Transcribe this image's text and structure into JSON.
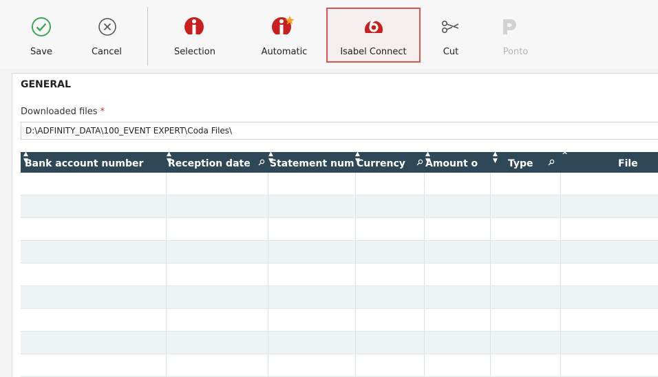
{
  "toolbar": {
    "save": "Save",
    "cancel": "Cancel",
    "selection": "Selection",
    "automatic": "Automatic",
    "isabel_connect": "Isabel Connect",
    "cut": "Cut",
    "ponto": "Ponto"
  },
  "colors": {
    "header_bg": "#2f4858",
    "save_green": "#3aa757",
    "brand_red": "#c8201e",
    "highlight_border": "#e05252"
  },
  "section": {
    "title": "GENERAL",
    "downloaded_files_label": "Downloaded files",
    "required_marker": "*",
    "downloaded_files_value": "D:\\ADFINITY_DATA\\100_EVENT EXPERT\\Coda Files\\"
  },
  "grid": {
    "columns": [
      "Bank account number",
      "Reception date",
      "Statement number",
      "Currency",
      "Amount o",
      "Type",
      "File"
    ],
    "rows": [
      [
        "",
        "",
        "",
        "",
        "",
        "",
        ""
      ],
      [
        "",
        "",
        "",
        "",
        "",
        "",
        ""
      ],
      [
        "",
        "",
        "",
        "",
        "",
        "",
        ""
      ],
      [
        "",
        "",
        "",
        "",
        "",
        "",
        ""
      ],
      [
        "",
        "",
        "",
        "",
        "",
        "",
        ""
      ],
      [
        "",
        "",
        "",
        "",
        "",
        "",
        ""
      ],
      [
        "",
        "",
        "",
        "",
        "",
        "",
        ""
      ],
      [
        "",
        "",
        "",
        "",
        "",
        "",
        ""
      ],
      [
        "",
        "",
        "",
        "",
        "",
        "",
        ""
      ]
    ]
  }
}
